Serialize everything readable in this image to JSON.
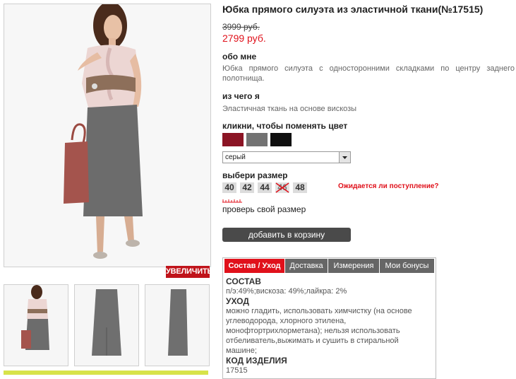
{
  "gallery": {
    "zoom_label": "УВЕЛИЧИТЬ"
  },
  "product": {
    "title": "Юбка прямого силуэта из эластичной ткани(№17515)",
    "old_price": "3999 руб.",
    "new_price": "2799 руб.",
    "about_heading": "обо мне",
    "about_text": "Юбка прямого силуэта с односторонними складками по центру заднего полотнища.",
    "material_heading": "из чего я",
    "material_text": "Эластичная ткань на основе вискозы",
    "color_heading": "кликни, чтобы поменять цвет",
    "colors": [
      "#8b1424",
      "#737373",
      "#101010"
    ],
    "selected_color": "серый",
    "size_heading": "выбери размер",
    "sizes": [
      "40",
      "42",
      "44",
      "46",
      "48"
    ],
    "unavailable_size": "46",
    "waiting_link": "Ожидается ли поступление?",
    "check_size": "проверь свой размер",
    "add_to_cart": "добавить в корзину"
  },
  "tabs": [
    "Состав / Уход",
    "Доставка",
    "Измерения",
    "Мои бонусы"
  ],
  "active_tab": "Состав / Уход",
  "details": {
    "composition_heading": "СОСТАВ",
    "composition_text": "п/э:49%;вискоза: 49%;лайкра: 2%",
    "care_heading": "УХОД",
    "care_text": "можно гладить, использовать химчистку (на основе углеводорода, хлорного этилена, монофтортрихлорметана); нельзя использовать отбеливатель,выжимать и сушить в стиральной машине;",
    "code_heading": "КОД ИЗДЕЛИЯ",
    "code_value": "17515"
  }
}
